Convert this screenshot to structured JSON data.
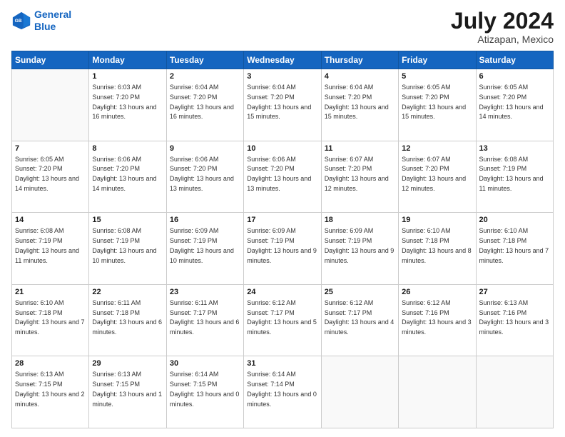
{
  "header": {
    "logo_line1": "General",
    "logo_line2": "Blue",
    "title": "July 2024",
    "subtitle": "Atizapan, Mexico"
  },
  "weekdays": [
    "Sunday",
    "Monday",
    "Tuesday",
    "Wednesday",
    "Thursday",
    "Friday",
    "Saturday"
  ],
  "weeks": [
    [
      {
        "day": "",
        "sunrise": "",
        "sunset": "",
        "daylight": ""
      },
      {
        "day": "1",
        "sunrise": "Sunrise: 6:03 AM",
        "sunset": "Sunset: 7:20 PM",
        "daylight": "Daylight: 13 hours and 16 minutes."
      },
      {
        "day": "2",
        "sunrise": "Sunrise: 6:04 AM",
        "sunset": "Sunset: 7:20 PM",
        "daylight": "Daylight: 13 hours and 16 minutes."
      },
      {
        "day": "3",
        "sunrise": "Sunrise: 6:04 AM",
        "sunset": "Sunset: 7:20 PM",
        "daylight": "Daylight: 13 hours and 15 minutes."
      },
      {
        "day": "4",
        "sunrise": "Sunrise: 6:04 AM",
        "sunset": "Sunset: 7:20 PM",
        "daylight": "Daylight: 13 hours and 15 minutes."
      },
      {
        "day": "5",
        "sunrise": "Sunrise: 6:05 AM",
        "sunset": "Sunset: 7:20 PM",
        "daylight": "Daylight: 13 hours and 15 minutes."
      },
      {
        "day": "6",
        "sunrise": "Sunrise: 6:05 AM",
        "sunset": "Sunset: 7:20 PM",
        "daylight": "Daylight: 13 hours and 14 minutes."
      }
    ],
    [
      {
        "day": "7",
        "sunrise": "Sunrise: 6:05 AM",
        "sunset": "Sunset: 7:20 PM",
        "daylight": "Daylight: 13 hours and 14 minutes."
      },
      {
        "day": "8",
        "sunrise": "Sunrise: 6:06 AM",
        "sunset": "Sunset: 7:20 PM",
        "daylight": "Daylight: 13 hours and 14 minutes."
      },
      {
        "day": "9",
        "sunrise": "Sunrise: 6:06 AM",
        "sunset": "Sunset: 7:20 PM",
        "daylight": "Daylight: 13 hours and 13 minutes."
      },
      {
        "day": "10",
        "sunrise": "Sunrise: 6:06 AM",
        "sunset": "Sunset: 7:20 PM",
        "daylight": "Daylight: 13 hours and 13 minutes."
      },
      {
        "day": "11",
        "sunrise": "Sunrise: 6:07 AM",
        "sunset": "Sunset: 7:20 PM",
        "daylight": "Daylight: 13 hours and 12 minutes."
      },
      {
        "day": "12",
        "sunrise": "Sunrise: 6:07 AM",
        "sunset": "Sunset: 7:20 PM",
        "daylight": "Daylight: 13 hours and 12 minutes."
      },
      {
        "day": "13",
        "sunrise": "Sunrise: 6:08 AM",
        "sunset": "Sunset: 7:19 PM",
        "daylight": "Daylight: 13 hours and 11 minutes."
      }
    ],
    [
      {
        "day": "14",
        "sunrise": "Sunrise: 6:08 AM",
        "sunset": "Sunset: 7:19 PM",
        "daylight": "Daylight: 13 hours and 11 minutes."
      },
      {
        "day": "15",
        "sunrise": "Sunrise: 6:08 AM",
        "sunset": "Sunset: 7:19 PM",
        "daylight": "Daylight: 13 hours and 10 minutes."
      },
      {
        "day": "16",
        "sunrise": "Sunrise: 6:09 AM",
        "sunset": "Sunset: 7:19 PM",
        "daylight": "Daylight: 13 hours and 10 minutes."
      },
      {
        "day": "17",
        "sunrise": "Sunrise: 6:09 AM",
        "sunset": "Sunset: 7:19 PM",
        "daylight": "Daylight: 13 hours and 9 minutes."
      },
      {
        "day": "18",
        "sunrise": "Sunrise: 6:09 AM",
        "sunset": "Sunset: 7:19 PM",
        "daylight": "Daylight: 13 hours and 9 minutes."
      },
      {
        "day": "19",
        "sunrise": "Sunrise: 6:10 AM",
        "sunset": "Sunset: 7:18 PM",
        "daylight": "Daylight: 13 hours and 8 minutes."
      },
      {
        "day": "20",
        "sunrise": "Sunrise: 6:10 AM",
        "sunset": "Sunset: 7:18 PM",
        "daylight": "Daylight: 13 hours and 7 minutes."
      }
    ],
    [
      {
        "day": "21",
        "sunrise": "Sunrise: 6:10 AM",
        "sunset": "Sunset: 7:18 PM",
        "daylight": "Daylight: 13 hours and 7 minutes."
      },
      {
        "day": "22",
        "sunrise": "Sunrise: 6:11 AM",
        "sunset": "Sunset: 7:18 PM",
        "daylight": "Daylight: 13 hours and 6 minutes."
      },
      {
        "day": "23",
        "sunrise": "Sunrise: 6:11 AM",
        "sunset": "Sunset: 7:17 PM",
        "daylight": "Daylight: 13 hours and 6 minutes."
      },
      {
        "day": "24",
        "sunrise": "Sunrise: 6:12 AM",
        "sunset": "Sunset: 7:17 PM",
        "daylight": "Daylight: 13 hours and 5 minutes."
      },
      {
        "day": "25",
        "sunrise": "Sunrise: 6:12 AM",
        "sunset": "Sunset: 7:17 PM",
        "daylight": "Daylight: 13 hours and 4 minutes."
      },
      {
        "day": "26",
        "sunrise": "Sunrise: 6:12 AM",
        "sunset": "Sunset: 7:16 PM",
        "daylight": "Daylight: 13 hours and 3 minutes."
      },
      {
        "day": "27",
        "sunrise": "Sunrise: 6:13 AM",
        "sunset": "Sunset: 7:16 PM",
        "daylight": "Daylight: 13 hours and 3 minutes."
      }
    ],
    [
      {
        "day": "28",
        "sunrise": "Sunrise: 6:13 AM",
        "sunset": "Sunset: 7:15 PM",
        "daylight": "Daylight: 13 hours and 2 minutes."
      },
      {
        "day": "29",
        "sunrise": "Sunrise: 6:13 AM",
        "sunset": "Sunset: 7:15 PM",
        "daylight": "Daylight: 13 hours and 1 minute."
      },
      {
        "day": "30",
        "sunrise": "Sunrise: 6:14 AM",
        "sunset": "Sunset: 7:15 PM",
        "daylight": "Daylight: 13 hours and 0 minutes."
      },
      {
        "day": "31",
        "sunrise": "Sunrise: 6:14 AM",
        "sunset": "Sunset: 7:14 PM",
        "daylight": "Daylight: 13 hours and 0 minutes."
      },
      {
        "day": "",
        "sunrise": "",
        "sunset": "",
        "daylight": ""
      },
      {
        "day": "",
        "sunrise": "",
        "sunset": "",
        "daylight": ""
      },
      {
        "day": "",
        "sunrise": "",
        "sunset": "",
        "daylight": ""
      }
    ]
  ]
}
